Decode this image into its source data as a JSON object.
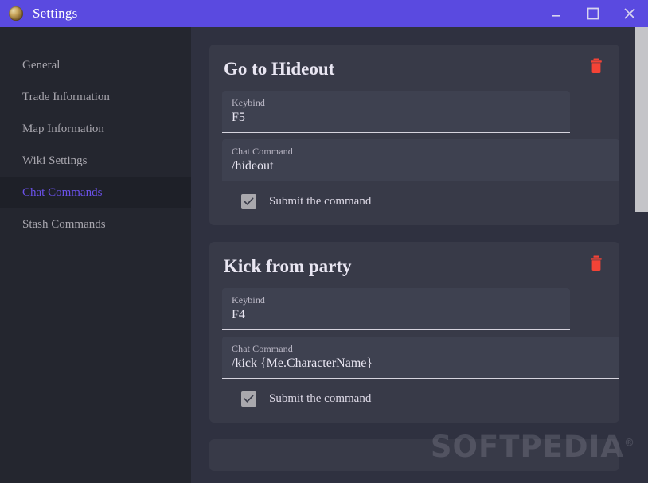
{
  "window": {
    "title": "Settings",
    "icon": "app-icon",
    "controls": {
      "minimize": "minimize-icon",
      "maximize": "maximize-icon",
      "close": "close-icon"
    },
    "accent_color": "#5a4ae0"
  },
  "sidebar": {
    "items": [
      {
        "label": "General",
        "active": false
      },
      {
        "label": "Trade Information",
        "active": false
      },
      {
        "label": "Map Information",
        "active": false
      },
      {
        "label": "Wiki Settings",
        "active": false
      },
      {
        "label": "Chat Commands",
        "active": true
      },
      {
        "label": "Stash Commands",
        "active": false
      }
    ],
    "active_color": "#6a51e8",
    "background": "#24262f"
  },
  "main": {
    "cards": [
      {
        "title": "Go to Hideout",
        "keybind_label": "Keybind",
        "keybind_value": "F5",
        "chat_command_label": "Chat Command",
        "chat_command_value": "/hideout",
        "submit_label": "Submit the command",
        "submit_checked": true,
        "delete_icon": "trash-icon",
        "clear_icon": "clear-circle-icon"
      },
      {
        "title": "Kick from party",
        "keybind_label": "Keybind",
        "keybind_value": "F4",
        "chat_command_label": "Chat Command",
        "chat_command_value": "/kick {Me.CharacterName}",
        "submit_label": "Submit the command",
        "submit_checked": true,
        "delete_icon": "trash-icon",
        "clear_icon": "clear-circle-icon"
      }
    ],
    "card_background": "#383a48",
    "field_background": "#3e4150",
    "delete_color": "#f44336"
  },
  "watermark": {
    "text": "SOFTPEDIA",
    "mark": "®"
  },
  "scrollbar": {
    "thumb_color": "#c4c4c8"
  }
}
